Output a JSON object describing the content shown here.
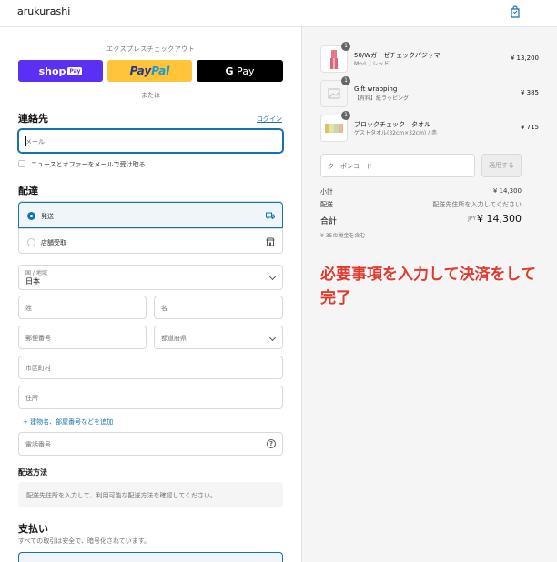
{
  "header": {
    "brand": "arukurashi",
    "cart_icon": "shopping-bag-icon"
  },
  "express": {
    "title": "エクスプレスチェックアウト",
    "shop_pay": {
      "text": "shop",
      "badge": "Pay"
    },
    "paypal": {
      "part1": "Pay",
      "part2": "Pal"
    },
    "gpay": {
      "g": "G",
      "text": " Pay"
    },
    "or": "または"
  },
  "contact": {
    "title": "連絡先",
    "login": "ログイン",
    "email_placeholder": "メール",
    "newsletter": "ニュースとオファーをメールで受け取る"
  },
  "delivery": {
    "title": "配達",
    "options": [
      {
        "label": "発送",
        "icon": "truck-icon",
        "selected": true
      },
      {
        "label": "店舗受取",
        "icon": "store-icon",
        "selected": false
      }
    ],
    "country_label": "国 / 地域",
    "country_value": "日本",
    "last_name": "姓",
    "first_name": "名",
    "postal_code": "郵便番号",
    "prefecture": "都道府県",
    "city": "市区町村",
    "address": "住所",
    "add_apartment": "+ 建物名、部屋番号などを追加",
    "phone": "電話番号"
  },
  "shipping_method": {
    "title": "配送方法",
    "info": "配送先住所を入力して、利用可能な配送方法を確認してください。"
  },
  "payment": {
    "title": "支払い",
    "subtitle": "すべての取引は安全で、暗号化されています。"
  },
  "summary": {
    "items": [
      {
        "qty": "1",
        "name": "50/Wガーゼチェックパジャマ",
        "variant": "M〜L / レッド",
        "price": "¥ 13,200"
      },
      {
        "qty": "1",
        "name": "Gift wrapping",
        "variant": "【有料】紙ラッピング",
        "price": "¥ 385"
      },
      {
        "qty": "1",
        "name": "ブロックチェック　タオル",
        "variant": "ゲストタオル(32cm×32cm) / 赤",
        "price": "¥ 715"
      }
    ],
    "coupon_placeholder": "クーポンコード",
    "apply": "適用する",
    "subtotal_label": "小計",
    "subtotal": "¥ 14,300",
    "shipping_label": "配送",
    "shipping_value": "配送先住所を入力してください",
    "total_label": "合計",
    "currency": "JPY",
    "total": "¥ 14,300",
    "tax_note": "¥ 35の税金を含む"
  },
  "annotation": "必要事項を入力して決済をして完了",
  "colors": {
    "accent": "#1773b0",
    "annotation": "#e03a2f",
    "shop_pay": "#5a31f4",
    "paypal": "#ffc439"
  }
}
